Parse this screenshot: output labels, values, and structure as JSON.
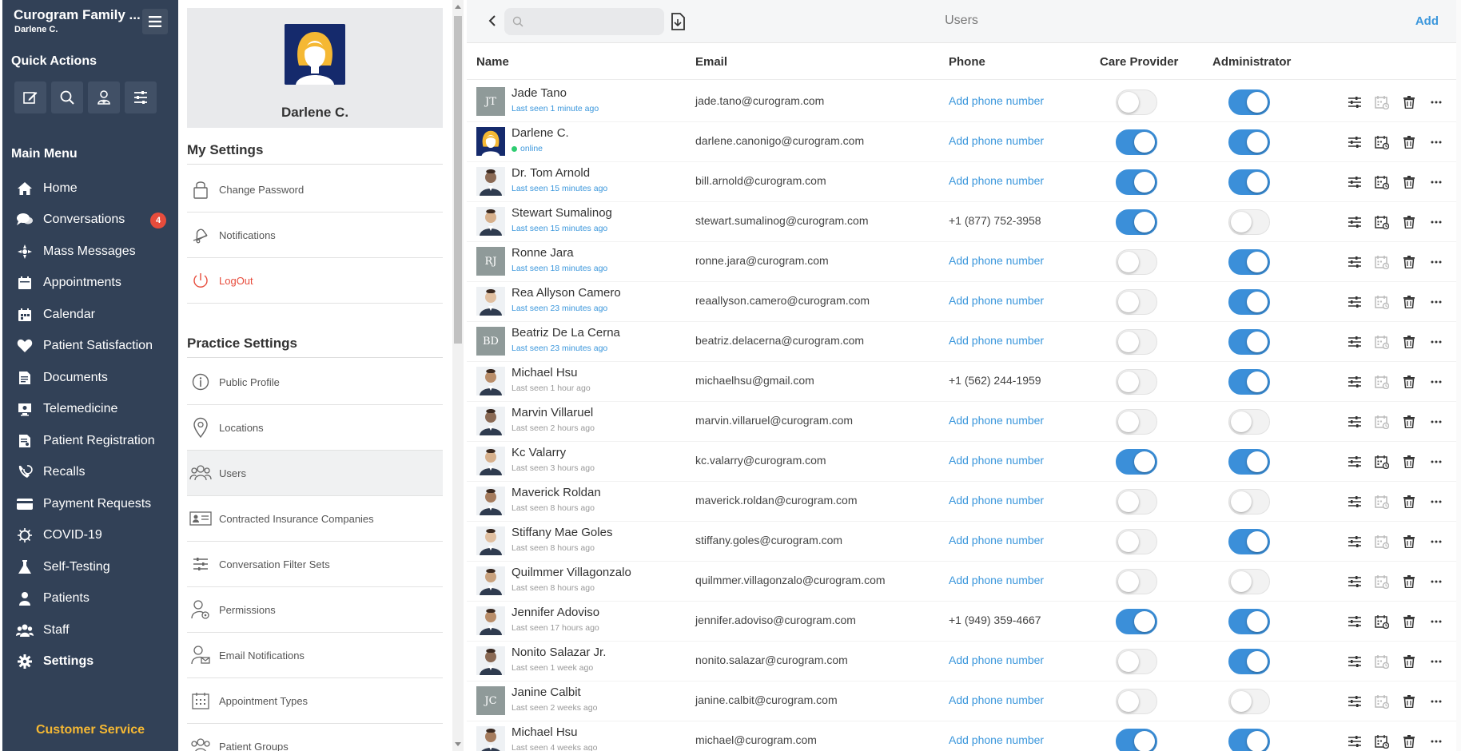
{
  "app": {
    "title": "Curogram Family ...",
    "user": "Darlene C."
  },
  "quick_actions": {
    "title": "Quick Actions",
    "buttons": [
      {
        "icon": "edit-icon"
      },
      {
        "icon": "search-icon"
      },
      {
        "icon": "add-patient-icon"
      },
      {
        "icon": "sliders-icon"
      }
    ]
  },
  "main_menu": {
    "title": "Main Menu",
    "items": [
      {
        "label": "Home",
        "icon": "home-icon"
      },
      {
        "label": "Conversations",
        "icon": "conversations-icon",
        "badge": "4"
      },
      {
        "label": "Mass Messages",
        "icon": "mass-messages-icon"
      },
      {
        "label": "Appointments",
        "icon": "appointments-icon"
      },
      {
        "label": "Calendar",
        "icon": "calendar-icon"
      },
      {
        "label": "Patient Satisfaction",
        "icon": "heart-icon"
      },
      {
        "label": "Documents",
        "icon": "documents-icon"
      },
      {
        "label": "Telemedicine",
        "icon": "telemedicine-icon"
      },
      {
        "label": "Patient Registration",
        "icon": "registration-icon"
      },
      {
        "label": "Recalls",
        "icon": "recalls-icon"
      },
      {
        "label": "Payment Requests",
        "icon": "card-icon"
      },
      {
        "label": "COVID-19",
        "icon": "virus-icon"
      },
      {
        "label": "Self-Testing",
        "icon": "flask-icon"
      },
      {
        "label": "Patients",
        "icon": "patient-icon"
      },
      {
        "label": "Staff",
        "icon": "staff-icon"
      },
      {
        "label": "Settings",
        "icon": "gear-icon",
        "active": true
      }
    ]
  },
  "customer_service": "Customer Service",
  "profile": {
    "name": "Darlene C."
  },
  "my_settings": {
    "title": "My Settings",
    "items": [
      {
        "label": "Change Password",
        "icon": "lock-icon"
      },
      {
        "label": "Notifications",
        "icon": "bell-icon"
      },
      {
        "label": "LogOut",
        "icon": "power-icon"
      }
    ]
  },
  "practice_settings": {
    "title": "Practice Settings",
    "items": [
      {
        "label": "Public Profile",
        "icon": "info-icon"
      },
      {
        "label": "Locations",
        "icon": "location-pin-icon"
      },
      {
        "label": "Users",
        "icon": "users-icon",
        "active": true
      },
      {
        "label": "Contracted Insurance Companies",
        "icon": "id-card-icon"
      },
      {
        "label": "Conversation Filter Sets",
        "icon": "filter-sliders-icon"
      },
      {
        "label": "Permissions",
        "icon": "user-gear-icon"
      },
      {
        "label": "Email Notifications",
        "icon": "user-email-icon"
      },
      {
        "label": "Appointment Types",
        "icon": "calendar-grid-icon"
      },
      {
        "label": "Patient Groups",
        "icon": "group-icon"
      }
    ]
  },
  "toolbar": {
    "search_placeholder": "",
    "title": "Users",
    "add_label": "Add"
  },
  "table": {
    "headers": {
      "name": "Name",
      "email": "Email",
      "phone": "Phone",
      "care_provider": "Care Provider",
      "administrator": "Administrator"
    },
    "rows": [
      {
        "name": "Jade Tano",
        "seen": "Last seen 1 minute ago",
        "seen_style": "blue",
        "avatar": "initials",
        "initials": "JT",
        "email": "jade.tano@curogram.com",
        "phone": "Add phone number",
        "care_provider": false,
        "administrator": true,
        "calendar_enabled": false
      },
      {
        "name": "Darlene C.",
        "seen": "online",
        "seen_style": "online",
        "avatar": "self",
        "email": "darlene.canonigo@curogram.com",
        "phone": "Add phone number",
        "care_provider": true,
        "administrator": true,
        "calendar_enabled": true
      },
      {
        "name": "Dr. Tom Arnold",
        "seen": "Last seen 15 minutes ago",
        "seen_style": "blue",
        "avatar": "photo",
        "email": "bill.arnold@curogram.com",
        "phone": "Add phone number",
        "care_provider": true,
        "administrator": true,
        "calendar_enabled": true
      },
      {
        "name": "Stewart Sumalinog",
        "seen": "Last seen 15 minutes ago",
        "seen_style": "blue",
        "avatar": "photo",
        "email": "stewart.sumalinog@curogram.com",
        "phone": "+1 (877) 752-3958",
        "care_provider": true,
        "administrator": false,
        "calendar_enabled": true
      },
      {
        "name": "Ronne Jara",
        "seen": "Last seen 18 minutes ago",
        "seen_style": "blue",
        "avatar": "initials",
        "initials": "RJ",
        "email": "ronne.jara@curogram.com",
        "phone": "Add phone number",
        "care_provider": false,
        "administrator": true,
        "calendar_enabled": false
      },
      {
        "name": "Rea Allyson Camero",
        "seen": "Last seen 23 minutes ago",
        "seen_style": "blue",
        "avatar": "photo",
        "email": "reaallyson.camero@curogram.com",
        "phone": "Add phone number",
        "care_provider": false,
        "administrator": true,
        "calendar_enabled": false
      },
      {
        "name": "Beatriz De La Cerna",
        "seen": "Last seen 23 minutes ago",
        "seen_style": "blue",
        "avatar": "initials",
        "initials": "BD",
        "email": "beatriz.delacerna@curogram.com",
        "phone": "Add phone number",
        "care_provider": false,
        "administrator": true,
        "calendar_enabled": false
      },
      {
        "name": "Michael Hsu",
        "seen": "Last seen 1 hour ago",
        "seen_style": "grey",
        "avatar": "photo",
        "email": "michaelhsu@gmail.com",
        "phone": "+1 (562) 244-1959",
        "care_provider": false,
        "administrator": true,
        "calendar_enabled": false
      },
      {
        "name": "Marvin Villaruel",
        "seen": "Last seen 2 hours ago",
        "seen_style": "grey",
        "avatar": "photo",
        "email": "marvin.villaruel@curogram.com",
        "phone": "Add phone number",
        "care_provider": false,
        "administrator": false,
        "calendar_enabled": false
      },
      {
        "name": "Kc Valarry",
        "seen": "Last seen 3 hours ago",
        "seen_style": "grey",
        "avatar": "photo",
        "email": "kc.valarry@curogram.com",
        "phone": "Add phone number",
        "care_provider": true,
        "administrator": true,
        "calendar_enabled": true
      },
      {
        "name": "Maverick Roldan",
        "seen": "Last seen 8 hours ago",
        "seen_style": "grey",
        "avatar": "photo",
        "email": "maverick.roldan@curogram.com",
        "phone": "Add phone number",
        "care_provider": false,
        "administrator": false,
        "calendar_enabled": false
      },
      {
        "name": "Stiffany Mae Goles",
        "seen": "Last seen 8 hours ago",
        "seen_style": "grey",
        "avatar": "photo",
        "email": "stiffany.goles@curogram.com",
        "phone": "Add phone number",
        "care_provider": false,
        "administrator": true,
        "calendar_enabled": false
      },
      {
        "name": "Quilmmer Villagonzalo",
        "seen": "Last seen 8 hours ago",
        "seen_style": "grey",
        "avatar": "photo",
        "email": "quilmmer.villagonzalo@curogram.com",
        "phone": "Add phone number",
        "care_provider": false,
        "administrator": false,
        "calendar_enabled": false
      },
      {
        "name": "Jennifer Adoviso",
        "seen": "Last seen 17 hours ago",
        "seen_style": "grey",
        "avatar": "photo",
        "email": "jennifer.adoviso@curogram.com",
        "phone": "+1 (949) 359-4667",
        "care_provider": true,
        "administrator": true,
        "calendar_enabled": true
      },
      {
        "name": "Nonito Salazar Jr.",
        "seen": "Last seen 1 week ago",
        "seen_style": "grey",
        "avatar": "photo",
        "email": "nonito.salazar@curogram.com",
        "phone": "Add phone number",
        "care_provider": false,
        "administrator": true,
        "calendar_enabled": false
      },
      {
        "name": "Janine Calbit",
        "seen": "Last seen 2 weeks ago",
        "seen_style": "grey",
        "avatar": "initials",
        "initials": "JC",
        "email": "janine.calbit@curogram.com",
        "phone": "Add phone number",
        "care_provider": false,
        "administrator": false,
        "calendar_enabled": false
      },
      {
        "name": "Michael Hsu",
        "seen": "Last seen 4 weeks ago",
        "seen_style": "grey",
        "avatar": "photo",
        "email": "michael@curogram.com",
        "phone": "Add phone number",
        "care_provider": true,
        "administrator": true,
        "calendar_enabled": true
      }
    ]
  },
  "colors": {
    "sidebar_bg": "#324157",
    "accent": "#3b8fd9",
    "link": "#3b97dc",
    "badge": "#e74c3c",
    "customer_service": "#f5b833",
    "logout": "#e74c3c"
  }
}
